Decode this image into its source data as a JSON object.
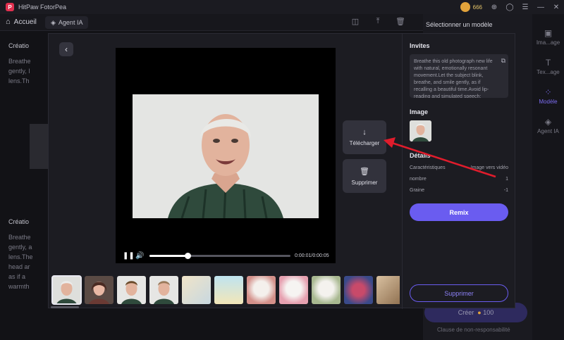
{
  "titlebar": {
    "app_title": "HitPaw FotorPea",
    "logo_letter": "P",
    "coins": "666"
  },
  "toolbar": {
    "home_label": "Accueil",
    "agent_tab_label": "Agent IA"
  },
  "background": {
    "items": [
      "Créatio",
      "Breathe",
      "gently, l",
      "lens.Th",
      "Créatio",
      "Breathe",
      "gently, a",
      "lens.The",
      "head ar",
      "as if a",
      "warmth"
    ],
    "right_panel_title": "Sélectionner un modèle",
    "rail": [
      "Ima...age",
      "Tex...age",
      "Modèle",
      "Agent IA"
    ],
    "create_label": "Créer",
    "create_cost": "100",
    "disclaimer": "Clause de non-responsabilité"
  },
  "modal": {
    "video": {
      "current_time": "0:00:01",
      "duration": "0:00:05",
      "progress": 0.27
    },
    "download_label": "Télécharger",
    "delete_side_label": "Supprimer",
    "panel": {
      "prompts_heading": "Invites",
      "prompt_text": "Breathe this old photograph new life with natural, emotionally resonant movement.Let the subject blink, breathe, and smile gently, as if recalling a beautiful time.Avoid lip-reading and simulated speech;",
      "image_heading": "Image",
      "details_heading": "Détails",
      "details": [
        {
          "label": "Caractéristiques",
          "value": "Image vers vidéo"
        },
        {
          "label": "nombre",
          "value": "1"
        },
        {
          "label": "Graine",
          "value": "-1"
        }
      ],
      "remix_label": "Remix",
      "delete_label": "Supprimer"
    }
  },
  "colors": {
    "accent": "#6a5cf0",
    "annotation_arrow": "#e01c2c"
  },
  "icons": [
    "logo-icon",
    "coin-icon",
    "home-icon",
    "agent-icon",
    "back-icon",
    "pause-icon",
    "volume-icon",
    "download-icon",
    "trash-icon",
    "copy-icon"
  ]
}
